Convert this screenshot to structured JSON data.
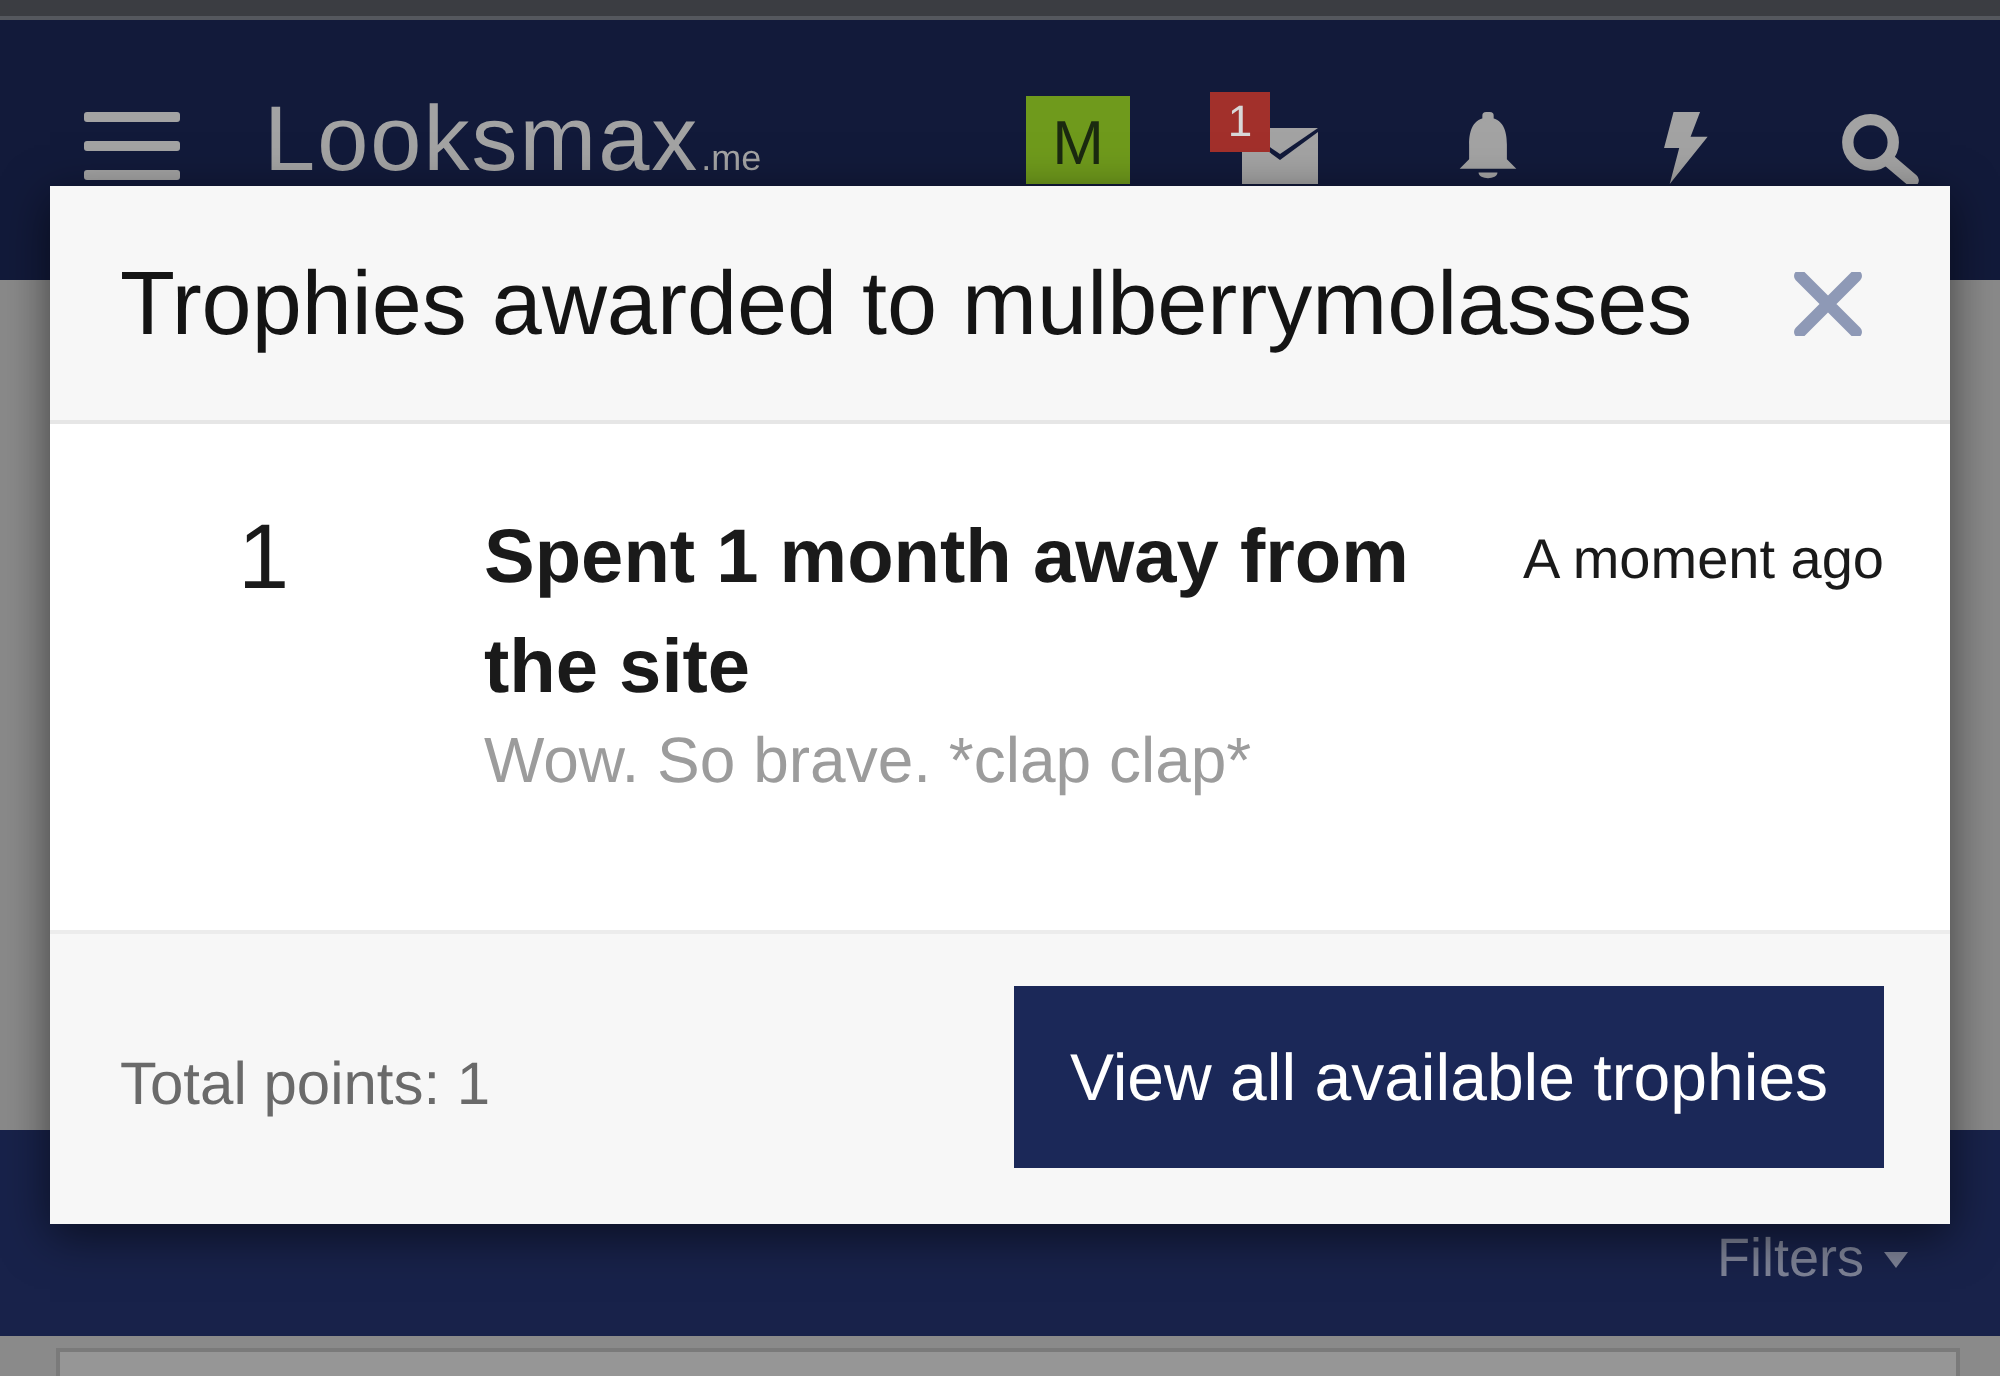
{
  "header": {
    "logo": "Looksmax",
    "logo_suffix": ".me",
    "avatar_letter": "M",
    "inbox_badge": "1"
  },
  "filter_bar": {
    "filters": "Filters"
  },
  "modal": {
    "title": "Trophies awarded to mulberrymolasses",
    "trophies": [
      {
        "points": "1",
        "title": "Spent 1 month away from the site",
        "description": "Wow. So brave. *clap clap*",
        "time": "A moment ago"
      }
    ],
    "total_points": "Total points: 1",
    "button": "View all available trophies"
  }
}
